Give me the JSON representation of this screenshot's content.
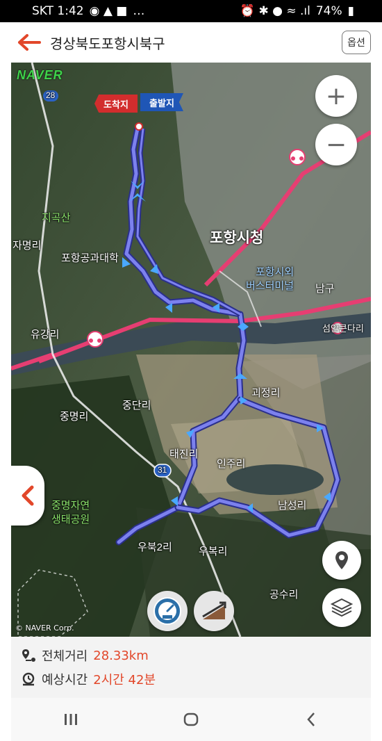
{
  "status": {
    "carrier_time": "SKT 1:42",
    "notifications": "…",
    "battery": "74%"
  },
  "appbar": {
    "title": "경상북도포항시북구",
    "options_label": "옵션"
  },
  "map": {
    "brand": "NAVER",
    "copyright": "© NAVER Corp.",
    "flag_end": "도착지",
    "flag_start": "출발지",
    "labels": {
      "city_hall": "포항시청",
      "terminal1": "포항시외",
      "terminal2": "버스터미널",
      "namgu": "남구",
      "jigoksan": "지곡산",
      "jamyeongri": "자명리",
      "postech": "포항공과대학",
      "yugangri": "유강리",
      "junggangdari": "섬안큰다리",
      "jungdanri": "중단리",
      "jungmyeongri": "중명리",
      "taejinri": "태진리",
      "inju": "인주리",
      "jungmyeong_park1": "중명자연",
      "jungmyeong_park2": "생태공원",
      "ubuk2ri": "우북2리",
      "ubukri": "우복리",
      "namseongri": "남성리",
      "gongsuri": "공수리",
      "jeongri": "괴정리",
      "road28": "28",
      "road31": "31"
    }
  },
  "info": {
    "distance_label": "전체거리",
    "distance_value": "28.33km",
    "time_label": "예상시간",
    "time_value": "2시간 42분"
  },
  "colors": {
    "accent": "#e2472a",
    "route": "#5b5fd6"
  }
}
